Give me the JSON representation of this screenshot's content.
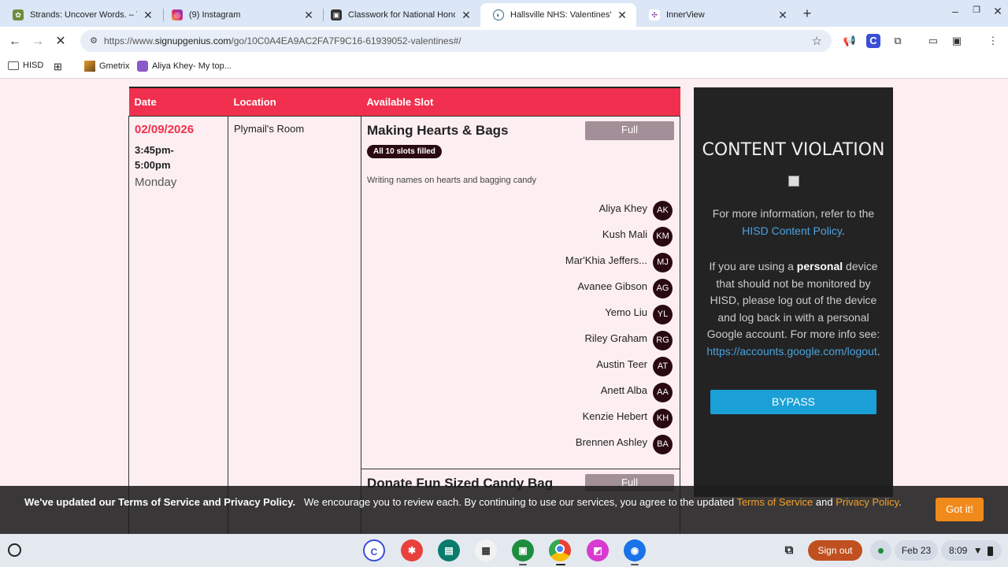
{
  "browser": {
    "tabs": [
      {
        "title": "Strands: Uncover Words. – The",
        "icon": "nyt-icon"
      },
      {
        "title": "(9) Instagram",
        "icon": "instagram-icon"
      },
      {
        "title": "Classwork for National Honor S",
        "icon": "classroom-icon"
      },
      {
        "title": "Hallsville NHS: Valentines' Day",
        "icon": "signupgenius-icon"
      },
      {
        "title": "InnerView",
        "icon": "innerview-icon"
      }
    ],
    "url_prefix": "https://www.",
    "url_domain": "signupgenius.com",
    "url_path": "/go/10C0A4EA9AC2FA7F9C16-61939052-valentines#/",
    "bookmarks": [
      "HISD",
      "Gmetrix",
      "Aliya Khey- My top..."
    ]
  },
  "table": {
    "headers": [
      "Date",
      "Location",
      "Available Slot"
    ],
    "date": "02/09/2026",
    "time_start": "3:45pm-",
    "time_end": "5:00pm",
    "day": "Monday",
    "location": "Plymail's Room",
    "slot1": {
      "title": "Making Hearts & Bags",
      "status": "Full",
      "badge": "All 10 slots filled",
      "description": "Writing names on hearts and bagging candy",
      "signups": [
        {
          "name": "Aliya Khey",
          "initials": "AK"
        },
        {
          "name": "Kush Mali",
          "initials": "KM"
        },
        {
          "name": "Mar'Khia Jeffers...",
          "initials": "MJ"
        },
        {
          "name": "Avanee Gibson",
          "initials": "AG"
        },
        {
          "name": "Yemo Liu",
          "initials": "YL"
        },
        {
          "name": "Riley Graham",
          "initials": "RG"
        },
        {
          "name": "Austin Teer",
          "initials": "AT"
        },
        {
          "name": "Anett Alba",
          "initials": "AA"
        },
        {
          "name": "Kenzie Hebert",
          "initials": "KH"
        },
        {
          "name": "Brennen Ashley",
          "initials": "BA"
        }
      ]
    },
    "slot2": {
      "title": "Donate Fun Sized Candy Bag",
      "status": "Full"
    }
  },
  "violation": {
    "title": "CONTENT VIOLATION",
    "info_prefix": "For more information, refer to the",
    "policy_link": "HISD Content Policy",
    "info_suffix": ".",
    "personal_pre": "If you are using a",
    "personal_bold": "personal",
    "personal_post": "device that should not be monitored by HISD, please log out of the device and log back in with a personal Google account. For more info see:",
    "logout_link": "https://accounts.google.com/logout",
    "logout_suffix": ".",
    "bypass": "BYPASS"
  },
  "cookie": {
    "bold": "We've updated our Terms of Service and Privacy Policy.",
    "text": "We encourage you to review each. By continuing to use our services, you agree to the updated",
    "tos_link": "Terms of Service",
    "and": "and",
    "privacy_link": "Privacy Policy",
    "period": ".",
    "button": "Got it!"
  },
  "shelf": {
    "signout": "Sign out",
    "date": "Feb 23",
    "time": "8:09"
  }
}
